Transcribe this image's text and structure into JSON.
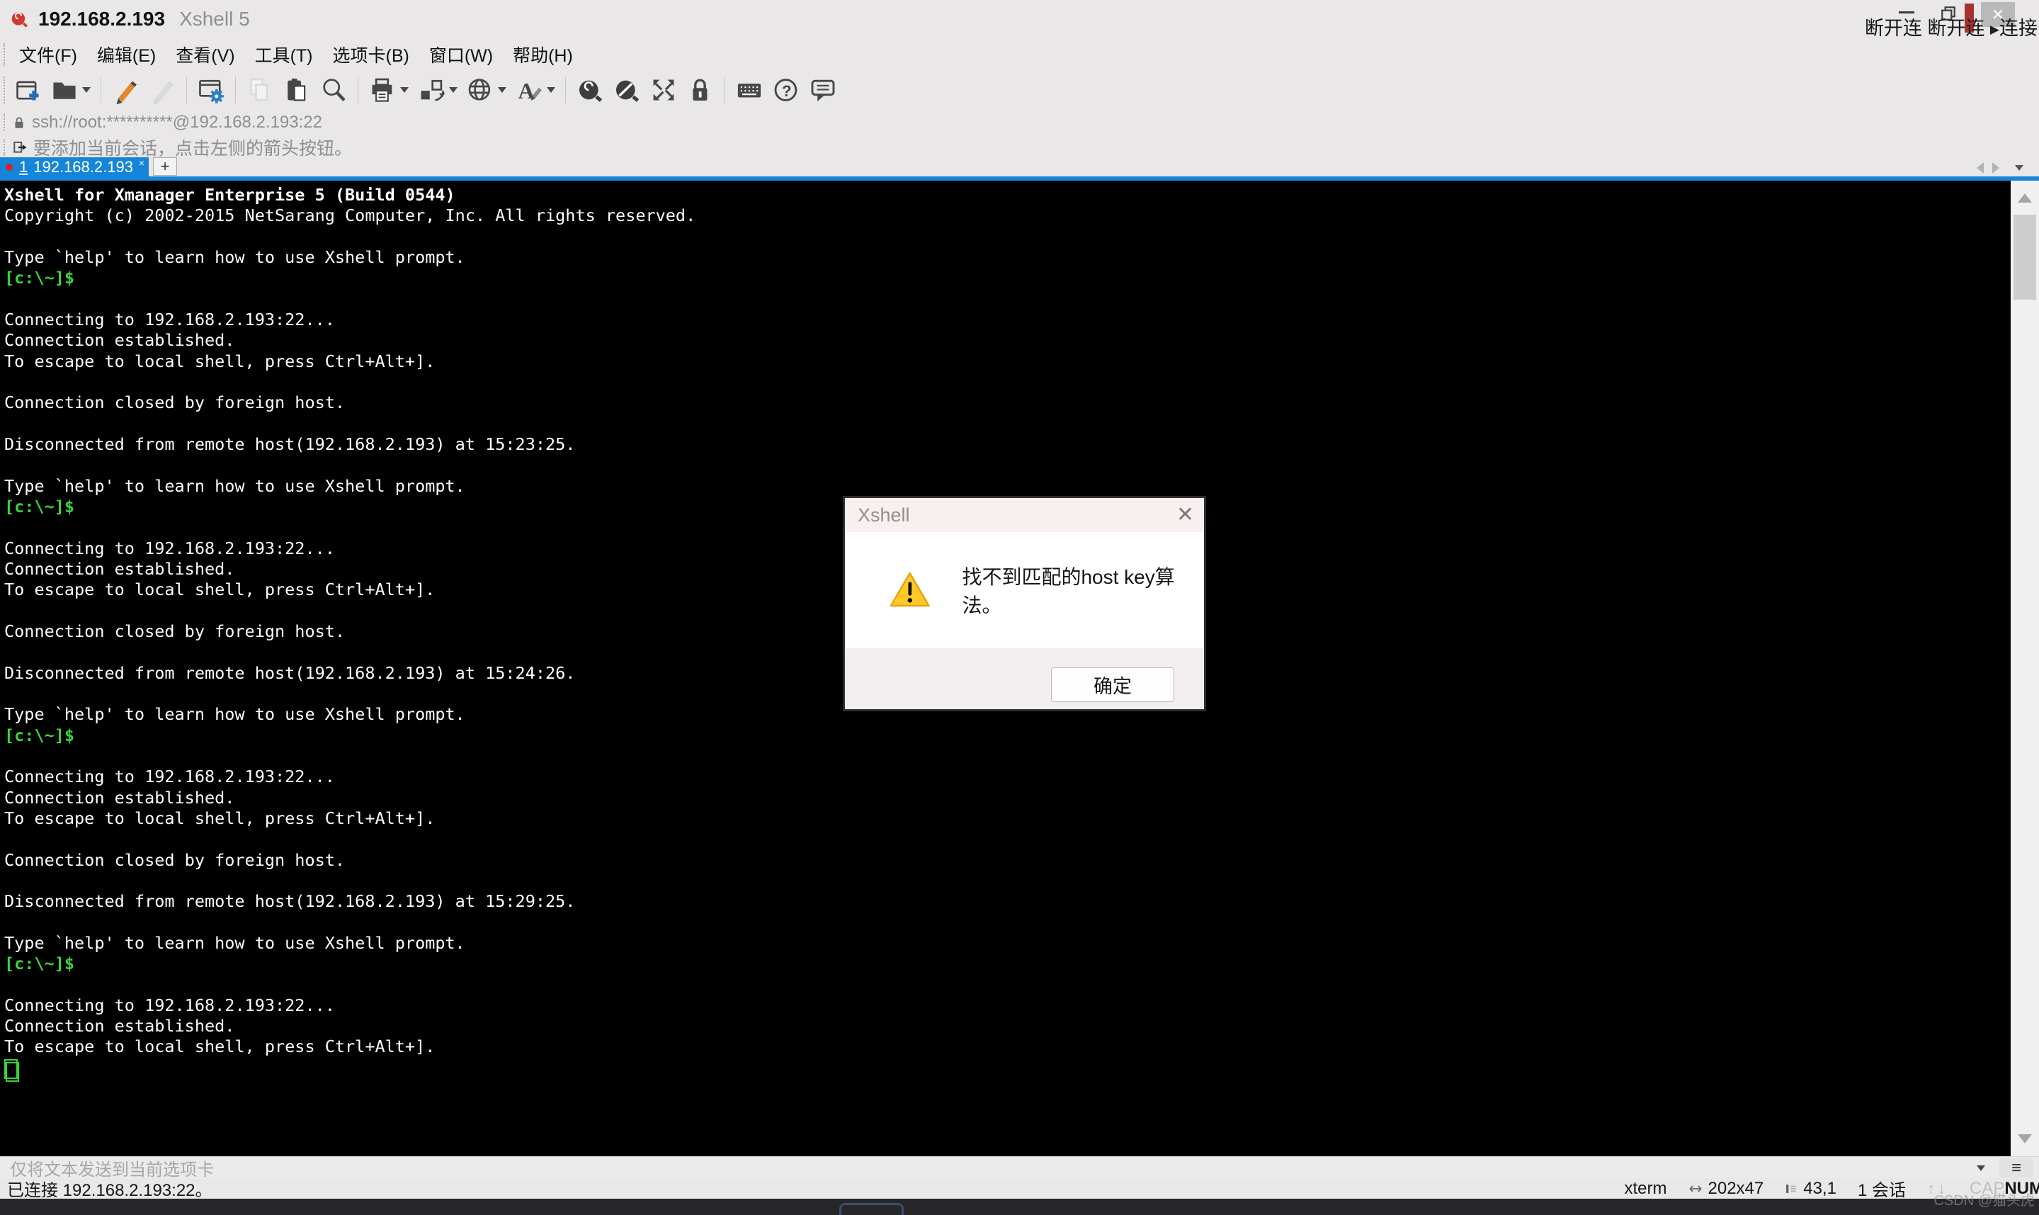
{
  "window": {
    "host": "192.168.2.193",
    "app": "Xshell 5",
    "close_glyph": "✕"
  },
  "caption_overlay": {
    "fragments": [
      "断开连",
      "断开连",
      "连接"
    ]
  },
  "menu": {
    "items": [
      "文件(F)",
      "编辑(E)",
      "查看(V)",
      "工具(T)",
      "选项卡(B)",
      "窗口(W)",
      "帮助(H)"
    ]
  },
  "toolbar": {
    "buttons": [
      {
        "name": "new-session-icon",
        "enabled": true,
        "dropdown": false,
        "sep_after": false
      },
      {
        "name": "open-session-icon",
        "enabled": true,
        "dropdown": true,
        "sep_after": true
      },
      {
        "name": "edit-session-icon",
        "enabled": true,
        "dropdown": false,
        "sep_after": false
      },
      {
        "name": "edit-session-disabled-icon",
        "enabled": false,
        "dropdown": false,
        "sep_after": true
      },
      {
        "name": "session-properties-icon",
        "enabled": true,
        "dropdown": false,
        "sep_after": true
      },
      {
        "name": "copy-icon",
        "enabled": false,
        "dropdown": false,
        "sep_after": false
      },
      {
        "name": "paste-icon",
        "enabled": true,
        "dropdown": false,
        "sep_after": false
      },
      {
        "name": "find-icon",
        "enabled": true,
        "dropdown": false,
        "sep_after": true
      },
      {
        "name": "print-icon",
        "enabled": true,
        "dropdown": true,
        "sep_after": false
      },
      {
        "name": "screen-capture-icon",
        "enabled": true,
        "dropdown": true,
        "sep_after": false
      },
      {
        "name": "web-browser-icon",
        "enabled": true,
        "dropdown": true,
        "sep_after": false
      },
      {
        "name": "font-icon",
        "enabled": true,
        "dropdown": true,
        "sep_after": true
      },
      {
        "name": "xagent-icon",
        "enabled": true,
        "dropdown": false,
        "sep_after": false
      },
      {
        "name": "xftp-icon",
        "enabled": true,
        "dropdown": false,
        "sep_after": false
      },
      {
        "name": "fullscreen-icon",
        "enabled": true,
        "dropdown": false,
        "sep_after": false
      },
      {
        "name": "lock-screen-icon",
        "enabled": true,
        "dropdown": false,
        "sep_after": true
      },
      {
        "name": "soft-keyboard-icon",
        "enabled": true,
        "dropdown": false,
        "sep_after": false
      },
      {
        "name": "help-icon",
        "enabled": true,
        "dropdown": false,
        "sep_after": false
      },
      {
        "name": "feedback-icon",
        "enabled": true,
        "dropdown": false,
        "sep_after": false
      }
    ]
  },
  "address_bar": {
    "url": "ssh://root:**********@192.168.2.193:22"
  },
  "quick_bar": {
    "hint": "要添加当前会话，点击左侧的箭头按钮。"
  },
  "tab_bar": {
    "active_tab": {
      "number": "1",
      "label": "192.168.2.193",
      "close_glyph": "×"
    },
    "new_tab_label": "+"
  },
  "terminal": {
    "lines": [
      {
        "s": "bold",
        "t": "Xshell for Xmanager Enterprise 5 (Build 0544)"
      },
      {
        "s": "plain",
        "t": "Copyright (c) 2002-2015 NetSarang Computer, Inc. All rights reserved."
      },
      {
        "s": "plain",
        "t": ""
      },
      {
        "s": "plain",
        "t": "Type `help' to learn how to use Xshell prompt."
      },
      {
        "s": "prompt",
        "t": "[c:\\~]$"
      },
      {
        "s": "plain",
        "t": ""
      },
      {
        "s": "plain",
        "t": "Connecting to 192.168.2.193:22..."
      },
      {
        "s": "plain",
        "t": "Connection established."
      },
      {
        "s": "plain",
        "t": "To escape to local shell, press Ctrl+Alt+]."
      },
      {
        "s": "plain",
        "t": ""
      },
      {
        "s": "plain",
        "t": "Connection closed by foreign host."
      },
      {
        "s": "plain",
        "t": ""
      },
      {
        "s": "plain",
        "t": "Disconnected from remote host(192.168.2.193) at 15:23:25."
      },
      {
        "s": "plain",
        "t": ""
      },
      {
        "s": "plain",
        "t": "Type `help' to learn how to use Xshell prompt."
      },
      {
        "s": "prompt",
        "t": "[c:\\~]$"
      },
      {
        "s": "plain",
        "t": ""
      },
      {
        "s": "plain",
        "t": "Connecting to 192.168.2.193:22..."
      },
      {
        "s": "plain",
        "t": "Connection established."
      },
      {
        "s": "plain",
        "t": "To escape to local shell, press Ctrl+Alt+]."
      },
      {
        "s": "plain",
        "t": ""
      },
      {
        "s": "plain",
        "t": "Connection closed by foreign host."
      },
      {
        "s": "plain",
        "t": ""
      },
      {
        "s": "plain",
        "t": "Disconnected from remote host(192.168.2.193) at 15:24:26."
      },
      {
        "s": "plain",
        "t": ""
      },
      {
        "s": "plain",
        "t": "Type `help' to learn how to use Xshell prompt."
      },
      {
        "s": "prompt",
        "t": "[c:\\~]$"
      },
      {
        "s": "plain",
        "t": ""
      },
      {
        "s": "plain",
        "t": "Connecting to 192.168.2.193:22..."
      },
      {
        "s": "plain",
        "t": "Connection established."
      },
      {
        "s": "plain",
        "t": "To escape to local shell, press Ctrl+Alt+]."
      },
      {
        "s": "plain",
        "t": ""
      },
      {
        "s": "plain",
        "t": "Connection closed by foreign host."
      },
      {
        "s": "plain",
        "t": ""
      },
      {
        "s": "plain",
        "t": "Disconnected from remote host(192.168.2.193) at 15:29:25."
      },
      {
        "s": "plain",
        "t": ""
      },
      {
        "s": "plain",
        "t": "Type `help' to learn how to use Xshell prompt."
      },
      {
        "s": "prompt",
        "t": "[c:\\~]$"
      },
      {
        "s": "plain",
        "t": ""
      },
      {
        "s": "plain",
        "t": "Connecting to 192.168.2.193:22..."
      },
      {
        "s": "plain",
        "t": "Connection established."
      },
      {
        "s": "plain",
        "t": "To escape to local shell, press Ctrl+Alt+]."
      },
      {
        "s": "cursor",
        "t": ""
      }
    ]
  },
  "dialog": {
    "title": "Xshell",
    "message": "找不到匹配的host key算法。",
    "ok_label": "确定",
    "close_glyph": "✕"
  },
  "send_bar": {
    "hint": "仅将文本发送到当前选项卡",
    "menu_glyph": "≡"
  },
  "status_bar": {
    "connected": "已连接 192.168.2.193:22。",
    "terminal_type": "xterm",
    "size": "202x47",
    "cursor_position": "43,1",
    "session_count": "1 会话",
    "updown_glyphs": "↑↓",
    "cap": "CAP",
    "num": "NUM"
  },
  "watermark": "CSDN @猫头虎",
  "colors": {
    "accent_blue": "#1585d9",
    "terminal_green": "#39d439",
    "warning_yellow": "#ffc928",
    "red_dot": "#e02020"
  }
}
